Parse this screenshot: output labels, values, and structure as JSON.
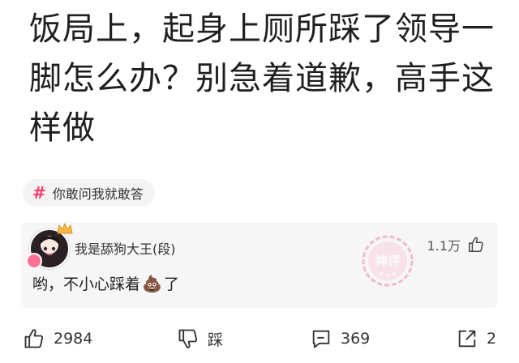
{
  "post": {
    "title": "饭局上，起身上厕所踩了领导一脚怎么办？别急着道歉，高手这样做"
  },
  "topic": {
    "label": "你敢问我就敢答"
  },
  "comment": {
    "username": "我是舔狗大王(段)",
    "likes": "1.1万",
    "text_before": "哟，不小心踩着",
    "text_after": "了",
    "stamp_text": "神评"
  },
  "actions": {
    "like_count": "2984",
    "dislike_label": "踩",
    "comment_count": "369",
    "share_count": "2"
  },
  "colors": {
    "accent": "#ff3a6f",
    "card_bg": "#f6f6f6"
  }
}
